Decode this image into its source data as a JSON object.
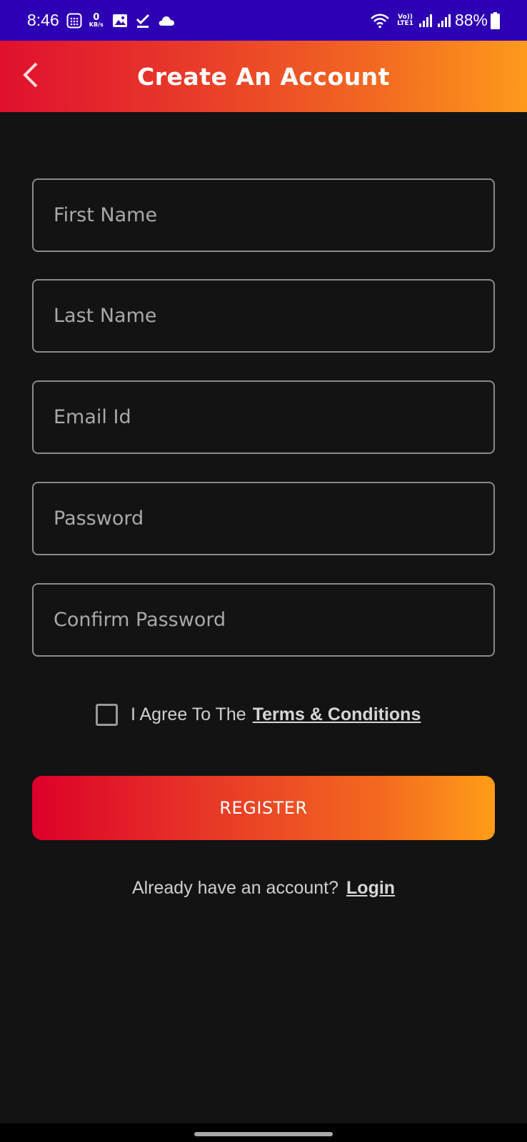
{
  "status_bar": {
    "time": "8:46",
    "net_speed_value": "0",
    "net_speed_unit": "KB/s",
    "lte_top": "Vo))",
    "lte_bottom": "LTE1",
    "battery": "88%"
  },
  "header": {
    "title": "Create An Account",
    "back_icon": "chevron-left-icon"
  },
  "form": {
    "first_name": {
      "placeholder": "First Name",
      "value": ""
    },
    "last_name": {
      "placeholder": "Last Name",
      "value": ""
    },
    "email": {
      "placeholder": "Email Id",
      "value": ""
    },
    "password": {
      "placeholder": "Password",
      "value": ""
    },
    "confirm_password": {
      "placeholder": "Confirm Password",
      "value": ""
    },
    "agree_text": "I Agree To The",
    "terms_link": "Terms & Conditions",
    "agree_checked": false
  },
  "register_button": "REGISTER",
  "login": {
    "prompt": "Already have an account?",
    "link": "Login"
  },
  "colors": {
    "status_bar": "#2e00b4",
    "background": "#131313",
    "gradient_start": "#dd0029",
    "gradient_end": "#ff9d18",
    "field_border": "#8a8a8a"
  }
}
